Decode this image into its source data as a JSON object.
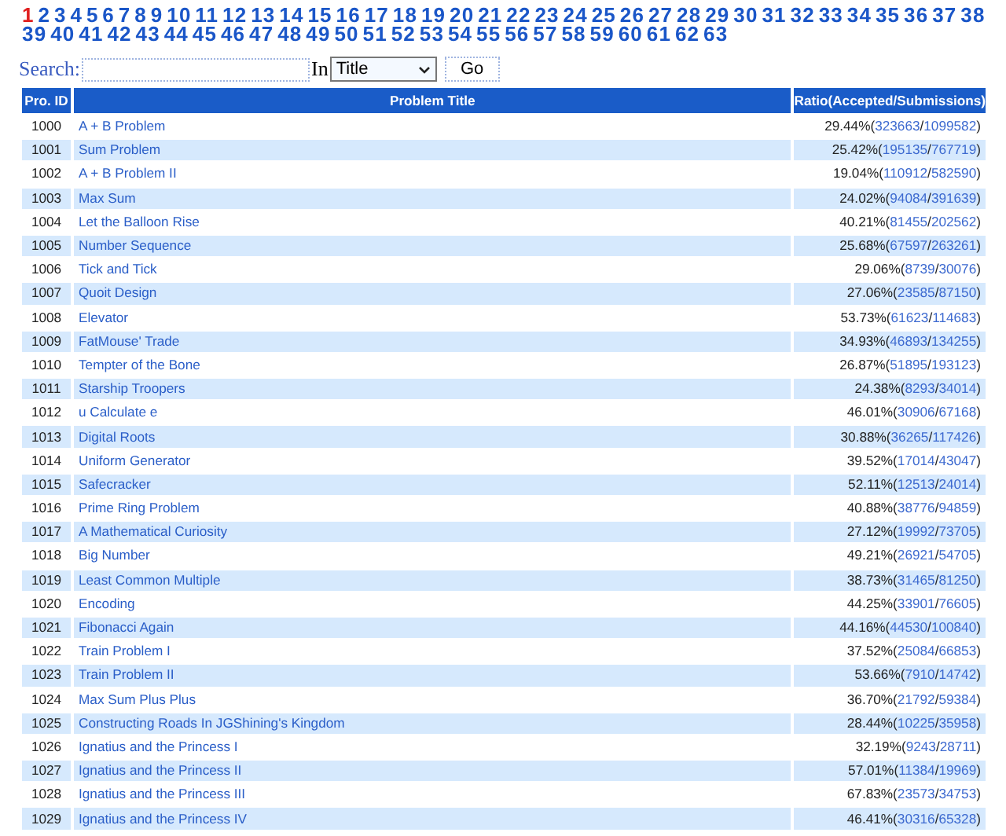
{
  "pages": [
    {
      "label": "1",
      "selected": true
    },
    {
      "label": "2",
      "selected": false
    },
    {
      "label": "3",
      "selected": false
    },
    {
      "label": "4",
      "selected": false
    },
    {
      "label": "5",
      "selected": false
    },
    {
      "label": "6",
      "selected": false
    },
    {
      "label": "7",
      "selected": false
    },
    {
      "label": "8",
      "selected": false
    },
    {
      "label": "9",
      "selected": false
    },
    {
      "label": "10",
      "selected": false
    },
    {
      "label": "11",
      "selected": false
    },
    {
      "label": "12",
      "selected": false
    },
    {
      "label": "13",
      "selected": false
    },
    {
      "label": "14",
      "selected": false
    },
    {
      "label": "15",
      "selected": false
    },
    {
      "label": "16",
      "selected": false
    },
    {
      "label": "17",
      "selected": false
    },
    {
      "label": "18",
      "selected": false
    },
    {
      "label": "19",
      "selected": false
    },
    {
      "label": "20",
      "selected": false
    },
    {
      "label": "21",
      "selected": false
    },
    {
      "label": "22",
      "selected": false
    },
    {
      "label": "23",
      "selected": false
    },
    {
      "label": "24",
      "selected": false
    },
    {
      "label": "25",
      "selected": false
    },
    {
      "label": "26",
      "selected": false
    },
    {
      "label": "27",
      "selected": false
    },
    {
      "label": "28",
      "selected": false
    },
    {
      "label": "29",
      "selected": false
    },
    {
      "label": "30",
      "selected": false
    },
    {
      "label": "31",
      "selected": false
    },
    {
      "label": "32",
      "selected": false
    },
    {
      "label": "33",
      "selected": false
    },
    {
      "label": "34",
      "selected": false
    },
    {
      "label": "35",
      "selected": false
    },
    {
      "label": "36",
      "selected": false
    },
    {
      "label": "37",
      "selected": false
    },
    {
      "label": "38",
      "selected": false
    },
    {
      "label": "39",
      "selected": false
    },
    {
      "label": "40",
      "selected": false
    },
    {
      "label": "41",
      "selected": false
    },
    {
      "label": "42",
      "selected": false
    },
    {
      "label": "43",
      "selected": false
    },
    {
      "label": "44",
      "selected": false
    },
    {
      "label": "45",
      "selected": false
    },
    {
      "label": "46",
      "selected": false
    },
    {
      "label": "47",
      "selected": false
    },
    {
      "label": "48",
      "selected": false
    },
    {
      "label": "49",
      "selected": false
    },
    {
      "label": "50",
      "selected": false
    },
    {
      "label": "51",
      "selected": false
    },
    {
      "label": "52",
      "selected": false
    },
    {
      "label": "53",
      "selected": false
    },
    {
      "label": "54",
      "selected": false
    },
    {
      "label": "55",
      "selected": false
    },
    {
      "label": "56",
      "selected": false
    },
    {
      "label": "57",
      "selected": false
    },
    {
      "label": "58",
      "selected": false
    },
    {
      "label": "59",
      "selected": false
    },
    {
      "label": "60",
      "selected": false
    },
    {
      "label": "61",
      "selected": false
    },
    {
      "label": "62",
      "selected": false
    },
    {
      "label": "63",
      "selected": false
    }
  ],
  "search": {
    "label": "Search:",
    "in_label": "In",
    "field": "Title",
    "button": "Go"
  },
  "table": {
    "columns": [
      "Pro. ID",
      "Problem Title",
      "Ratio(Accepted/Submissions)"
    ],
    "rows": [
      {
        "id": "1000",
        "title": "A + B Problem",
        "ratio": [
          "29.44%(",
          "323663",
          "/",
          "1099582",
          ")"
        ]
      },
      {
        "id": "1001",
        "title": "Sum Problem",
        "ratio": [
          "25.42%(",
          "195135",
          "/",
          "767719",
          ")"
        ]
      },
      {
        "id": "1002",
        "title": "A + B Problem II",
        "ratio": [
          "19.04%(",
          "110912",
          "/",
          "582590",
          ")"
        ]
      },
      {
        "id": "1003",
        "title": "Max Sum",
        "ratio": [
          "24.02%(",
          "94084",
          "/",
          "391639",
          ")"
        ]
      },
      {
        "id": "1004",
        "title": "Let the Balloon Rise",
        "ratio": [
          "40.21%(",
          "81455",
          "/",
          "202562",
          ")"
        ]
      },
      {
        "id": "1005",
        "title": "Number Sequence",
        "ratio": [
          "25.68%(",
          "67597",
          "/",
          "263261",
          ")"
        ]
      },
      {
        "id": "1006",
        "title": "Tick and Tick",
        "ratio": [
          "29.06%(",
          "8739",
          "/",
          "30076",
          ")"
        ]
      },
      {
        "id": "1007",
        "title": "Quoit Design",
        "ratio": [
          "27.06%(",
          "23585",
          "/",
          "87150",
          ")"
        ]
      },
      {
        "id": "1008",
        "title": "Elevator",
        "ratio": [
          "53.73%(",
          "61623",
          "/",
          "114683",
          ")"
        ]
      },
      {
        "id": "1009",
        "title": "FatMouse' Trade",
        "ratio": [
          "34.93%(",
          "46893",
          "/",
          "134255",
          ")"
        ]
      },
      {
        "id": "1010",
        "title": "Tempter of the Bone",
        "ratio": [
          "26.87%(",
          "51895",
          "/",
          "193123",
          ")"
        ]
      },
      {
        "id": "1011",
        "title": "Starship Troopers",
        "ratio": [
          "24.38%(",
          "8293",
          "/",
          "34014",
          ")"
        ]
      },
      {
        "id": "1012",
        "title": "u Calculate e",
        "ratio": [
          "46.01%(",
          "30906",
          "/",
          "67168",
          ")"
        ]
      },
      {
        "id": "1013",
        "title": "Digital Roots",
        "ratio": [
          "30.88%(",
          "36265",
          "/",
          "117426",
          ")"
        ]
      },
      {
        "id": "1014",
        "title": "Uniform Generator",
        "ratio": [
          "39.52%(",
          "17014",
          "/",
          "43047",
          ")"
        ]
      },
      {
        "id": "1015",
        "title": "Safecracker",
        "ratio": [
          "52.11%(",
          "12513",
          "/",
          "24014",
          ")"
        ]
      },
      {
        "id": "1016",
        "title": "Prime Ring Problem",
        "ratio": [
          "40.88%(",
          "38776",
          "/",
          "94859",
          ")"
        ]
      },
      {
        "id": "1017",
        "title": "A Mathematical Curiosity",
        "ratio": [
          "27.12%(",
          "19992",
          "/",
          "73705",
          ")"
        ]
      },
      {
        "id": "1018",
        "title": "Big Number",
        "ratio": [
          "49.21%(",
          "26921",
          "/",
          "54705",
          ")"
        ]
      },
      {
        "id": "1019",
        "title": "Least Common Multiple",
        "ratio": [
          "38.73%(",
          "31465",
          "/",
          "81250",
          ")"
        ]
      },
      {
        "id": "1020",
        "title": "Encoding",
        "ratio": [
          "44.25%(",
          "33901",
          "/",
          "76605",
          ")"
        ]
      },
      {
        "id": "1021",
        "title": "Fibonacci Again",
        "ratio": [
          "44.16%(",
          "44530",
          "/",
          "100840",
          ")"
        ]
      },
      {
        "id": "1022",
        "title": "Train Problem I",
        "ratio": [
          "37.52%(",
          "25084",
          "/",
          "66853",
          ")"
        ]
      },
      {
        "id": "1023",
        "title": "Train Problem II",
        "ratio": [
          "53.66%(",
          "7910",
          "/",
          "14742",
          ")"
        ]
      },
      {
        "id": "1024",
        "title": "Max Sum Plus Plus",
        "ratio": [
          "36.70%(",
          "21792",
          "/",
          "59384",
          ")"
        ]
      },
      {
        "id": "1025",
        "title": "Constructing Roads In JGShining's Kingdom",
        "ratio": [
          "28.44%(",
          "10225",
          "/",
          "35958",
          ")"
        ]
      },
      {
        "id": "1026",
        "title": "Ignatius and the Princess I",
        "ratio": [
          "32.19%(",
          "9243",
          "/",
          "28711",
          ")"
        ]
      },
      {
        "id": "1027",
        "title": "Ignatius and the Princess II",
        "ratio": [
          "57.01%(",
          "11384",
          "/",
          "19969",
          ")"
        ]
      },
      {
        "id": "1028",
        "title": "Ignatius and the Princess III",
        "ratio": [
          "67.83%(",
          "23573",
          "/",
          "34753",
          ")"
        ]
      },
      {
        "id": "1029",
        "title": "Ignatius and the Princess IV",
        "ratio": [
          "46.41%(",
          "30316",
          "/",
          "65328",
          ")"
        ]
      }
    ]
  }
}
